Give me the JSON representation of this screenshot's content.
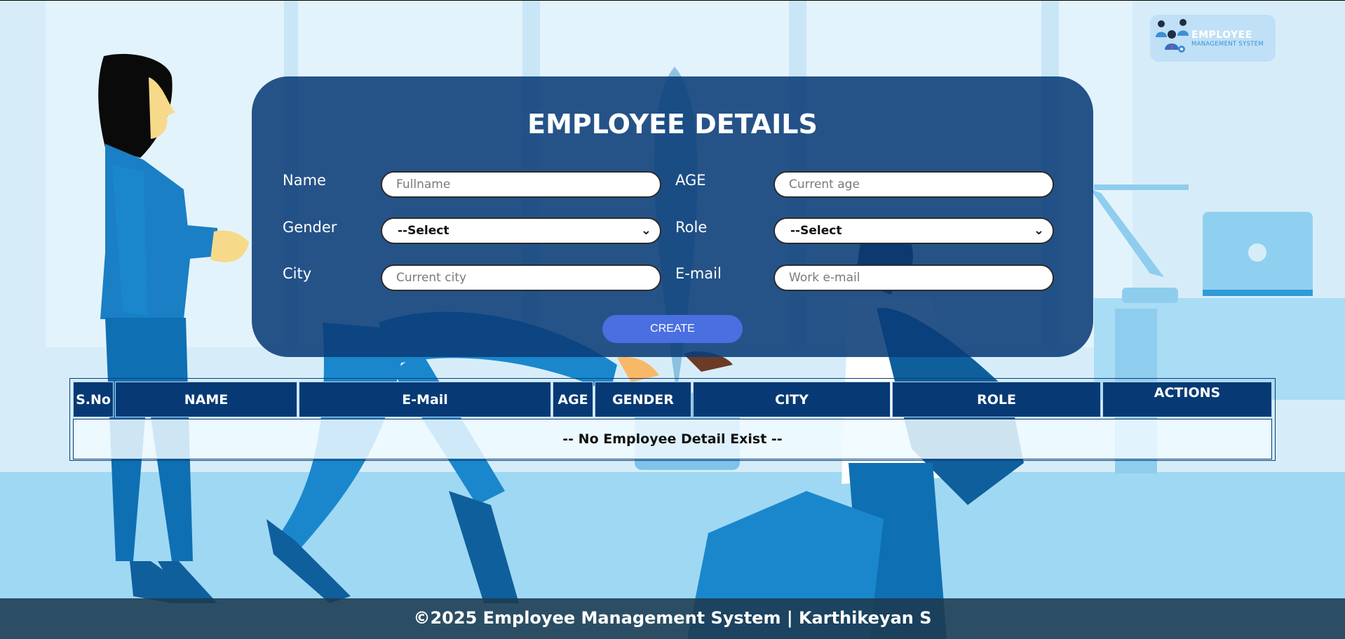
{
  "logo": {
    "title": "EMPLOYEE",
    "subtitle": "MANAGEMENT SYSTEM"
  },
  "form": {
    "title": "EMPLOYEE DETAILS",
    "name_label": "Name",
    "name_placeholder": "Fullname",
    "age_label": "AGE",
    "age_placeholder": "Current age",
    "gender_label": "Gender",
    "gender_selected": "--Select",
    "role_label": "Role",
    "role_selected": "--Select",
    "city_label": "City",
    "city_placeholder": "Current city",
    "email_label": "E-mail",
    "email_placeholder": "Work e-mail",
    "create_label": "CREATE"
  },
  "table": {
    "columns": [
      "S.No",
      "NAME",
      "E-Mail",
      "AGE",
      "GENDER",
      "CITY",
      "ROLE",
      "ACTIONS"
    ],
    "empty_message": "-- No Employee Detail Exist --"
  },
  "footer": {
    "text": "©2025 Employee Management System | Karthikeyan S"
  },
  "colors": {
    "panel": "#0a3c78",
    "table_header": "#073a74",
    "button": "#4a6fe0",
    "background": "#d6edf9"
  }
}
